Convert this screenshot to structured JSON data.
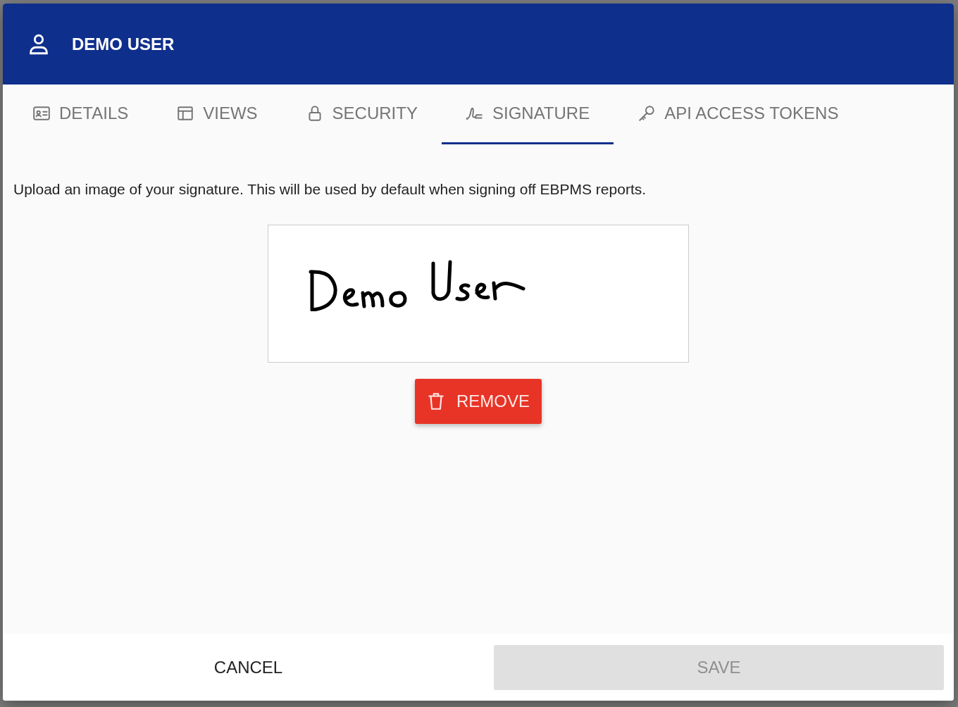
{
  "dialog": {
    "title": "DEMO USER"
  },
  "tabs": [
    {
      "label": "DETAILS",
      "selected": false
    },
    {
      "label": "VIEWS",
      "selected": false
    },
    {
      "label": "SECURITY",
      "selected": false
    },
    {
      "label": "SIGNATURE",
      "selected": true
    },
    {
      "label": "API ACCESS TOKENS",
      "selected": false
    }
  ],
  "description": "Upload an image of your signature. This will be used by default when signing off EBPMS reports.",
  "remove_button": "REMOVE",
  "footer": {
    "cancel": "CANCEL",
    "save": {
      "label": "SAVE",
      "disabled": true
    }
  }
}
